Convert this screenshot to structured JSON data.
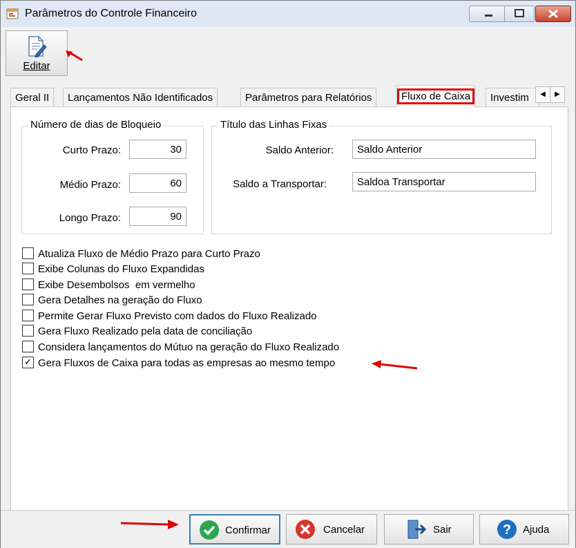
{
  "window": {
    "title": "Parâmetros do Controle Financeiro",
    "min_glyph": "▭",
    "max_glyph": "□",
    "close_glyph": "✕"
  },
  "toolbar": {
    "edit_label": "Editar",
    "edit_icon": "edit-document-icon"
  },
  "tabs": [
    {
      "label": "Geral II"
    },
    {
      "label": "Lançamentos Não Identificados"
    },
    {
      "label": "Parâmetros para Relatórios"
    },
    {
      "label": "Fluxo de Caixa",
      "active": true
    },
    {
      "label": "Investim"
    }
  ],
  "tab_scroll": {
    "left": "◀",
    "right": "▶"
  },
  "bloqueio": {
    "title": "Número de dias de Bloqueio",
    "curto_label": "Curto Prazo:",
    "curto_value": "30",
    "medio_label": "Médio Prazo:",
    "medio_value": "60",
    "longo_label": "Longo Prazo:",
    "longo_value": "90"
  },
  "linhas_fixas": {
    "title": "Título das Linhas Fixas",
    "saldo_anterior_label": "Saldo Anterior:",
    "saldo_anterior_value": "Saldo Anterior",
    "saldo_transportar_label": "Saldo a Transportar:",
    "saldo_transportar_value": "Saldoa Transportar"
  },
  "options": [
    {
      "label": "Atualiza Fluxo de Médio Prazo para Curto Prazo",
      "checked": false
    },
    {
      "label": "Exibe Colunas do Fluxo Expandidas",
      "checked": false
    },
    {
      "label": "Exibe Desembolsos  em vermelho",
      "checked": false
    },
    {
      "label": "Gera Detalhes na geração do Fluxo",
      "checked": false
    },
    {
      "label": "Permite Gerar Fluxo Previsto com dados do Fluxo Realizado",
      "checked": false
    },
    {
      "label": "Gera Fluxo Realizado pela data de conciliação",
      "checked": false
    },
    {
      "label": "Considera lançamentos do Mútuo na geração do Fluxo Realizado",
      "checked": false
    },
    {
      "label": "Gera Fluxos de Caixa para todas as empresas ao mesmo tempo",
      "checked": true
    }
  ],
  "check_glyph": "✓",
  "buttons": {
    "confirmar": "Confirmar",
    "cancelar": "Cancelar",
    "sair": "Sair",
    "ajuda": "Ajuda"
  },
  "colors": {
    "highlight_red": "#e00000",
    "confirm_green": "#2ea44f",
    "cancel_red": "#d9342b",
    "help_blue": "#1f6fbf"
  }
}
